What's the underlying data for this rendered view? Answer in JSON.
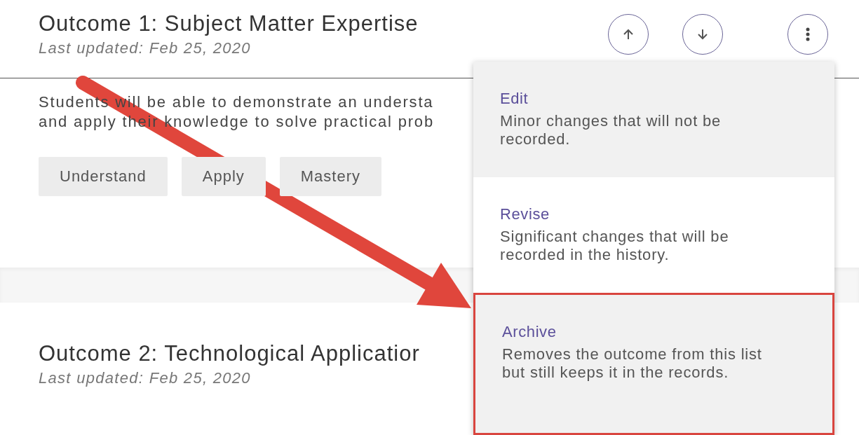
{
  "outcomes": [
    {
      "title": "Outcome 1: Subject Matter Expertise",
      "updated": "Last updated: Feb 25, 2020",
      "description_lines": [
        "Students will be able to demonstrate an understa",
        "and apply their knowledge to solve practical prob"
      ],
      "tags": [
        "Understand",
        "Apply",
        "Mastery"
      ]
    },
    {
      "title": "Outcome 2: Technological Applicatior",
      "updated": "Last updated: Feb 25, 2020"
    }
  ],
  "actions": [
    {
      "kind": "up"
    },
    {
      "kind": "down"
    },
    {
      "kind": "more"
    }
  ],
  "menu": [
    {
      "label": "Edit",
      "description": "Minor changes that will not be recorded.",
      "shaded": true,
      "outlined": false
    },
    {
      "label": "Revise",
      "description": "Significant changes that will be recorded in the history.",
      "shaded": false,
      "outlined": false
    },
    {
      "label": "Archive",
      "description": "Removes the outcome from this list but still keeps it in the records.",
      "shaded": true,
      "outlined": true
    }
  ],
  "annotation": {
    "kind": "arrow"
  }
}
